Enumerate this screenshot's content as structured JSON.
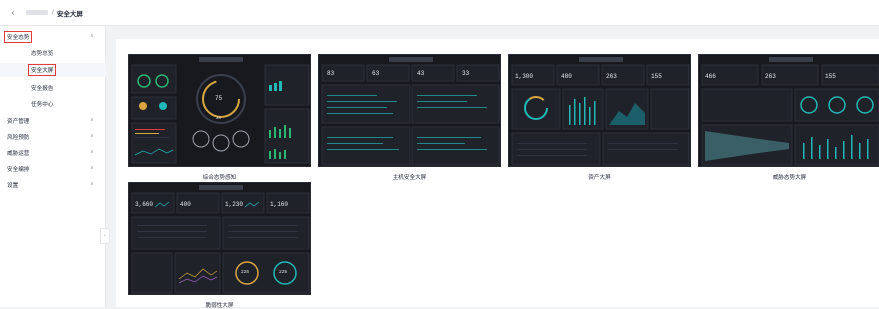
{
  "header": {
    "back_icon": "chevron-left-icon",
    "breadcrumb_separator": "/",
    "breadcrumb_current": "安全大屏"
  },
  "sidebar": {
    "groups": [
      {
        "label": "安全态势",
        "expanded": true,
        "boxed": true,
        "children": [
          {
            "label": "态势总览"
          },
          {
            "label": "安全大屏",
            "active": true,
            "boxed": true
          },
          {
            "label": "安全报告"
          },
          {
            "label": "任务中心"
          }
        ]
      },
      {
        "label": "资产管理"
      },
      {
        "label": "风险预防"
      },
      {
        "label": "威胁运营"
      },
      {
        "label": "安全编排"
      },
      {
        "label": "设置"
      }
    ],
    "collapse_icon": "chevron-left-icon"
  },
  "screens": [
    {
      "label": "综合态势感知",
      "stats": [
        "75",
        "28"
      ]
    },
    {
      "label": "主机安全大屏",
      "stats": [
        "83",
        "63",
        "43",
        "33"
      ]
    },
    {
      "label": "资产大屏",
      "stats": [
        "1,300",
        "480",
        "263",
        "155"
      ]
    },
    {
      "label": "威胁态势大屏",
      "stats": [
        "466",
        "263",
        "155"
      ]
    },
    {
      "label": "脆弱性大屏",
      "stats": [
        "3,660",
        "400",
        "1,230",
        "1,160",
        "225",
        "225"
      ]
    }
  ],
  "colors": {
    "accent_red": "#e03c3c",
    "teal": "#22b8b8",
    "dark_bg": "#17191f"
  }
}
